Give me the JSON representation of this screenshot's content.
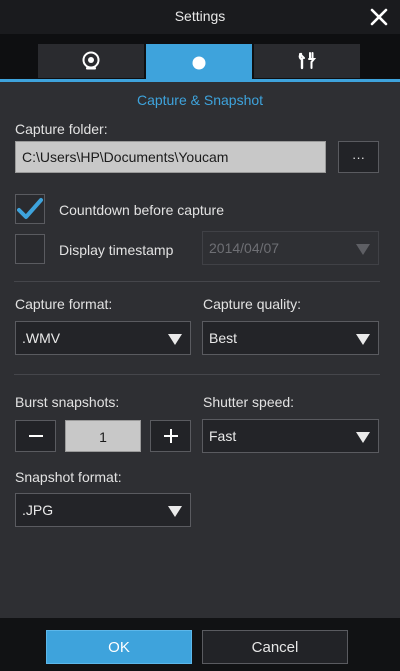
{
  "window": {
    "title": "Settings"
  },
  "tabs": [
    {
      "name": "webcam",
      "icon": "webcam-icon",
      "active": false
    },
    {
      "name": "capture",
      "icon": "record-dot-icon",
      "active": true
    },
    {
      "name": "tools",
      "icon": "tools-icon",
      "active": false
    }
  ],
  "section": {
    "title": "Capture & Snapshot"
  },
  "capture_folder": {
    "label": "Capture folder:",
    "value": "C:\\Users\\HP\\Documents\\Youcam",
    "browse_label": "···"
  },
  "countdown": {
    "label": "Countdown before capture",
    "checked": true
  },
  "timestamp": {
    "label": "Display timestamp",
    "checked": false,
    "format_value": "2014/04/07"
  },
  "capture_format": {
    "label": "Capture format:",
    "value": ".WMV"
  },
  "capture_quality": {
    "label": "Capture quality:",
    "value": "Best"
  },
  "burst": {
    "label": "Burst snapshots:",
    "value": "1",
    "minus_label": "−",
    "plus_label": "+"
  },
  "shutter_speed": {
    "label": "Shutter speed:",
    "value": "Fast"
  },
  "snapshot_format": {
    "label": "Snapshot format:",
    "value": ".JPG"
  },
  "footer": {
    "ok_label": "OK",
    "cancel_label": "Cancel"
  },
  "colors": {
    "accent": "#3ea3dc",
    "panel": "#2e2f33",
    "background": "#111214"
  }
}
